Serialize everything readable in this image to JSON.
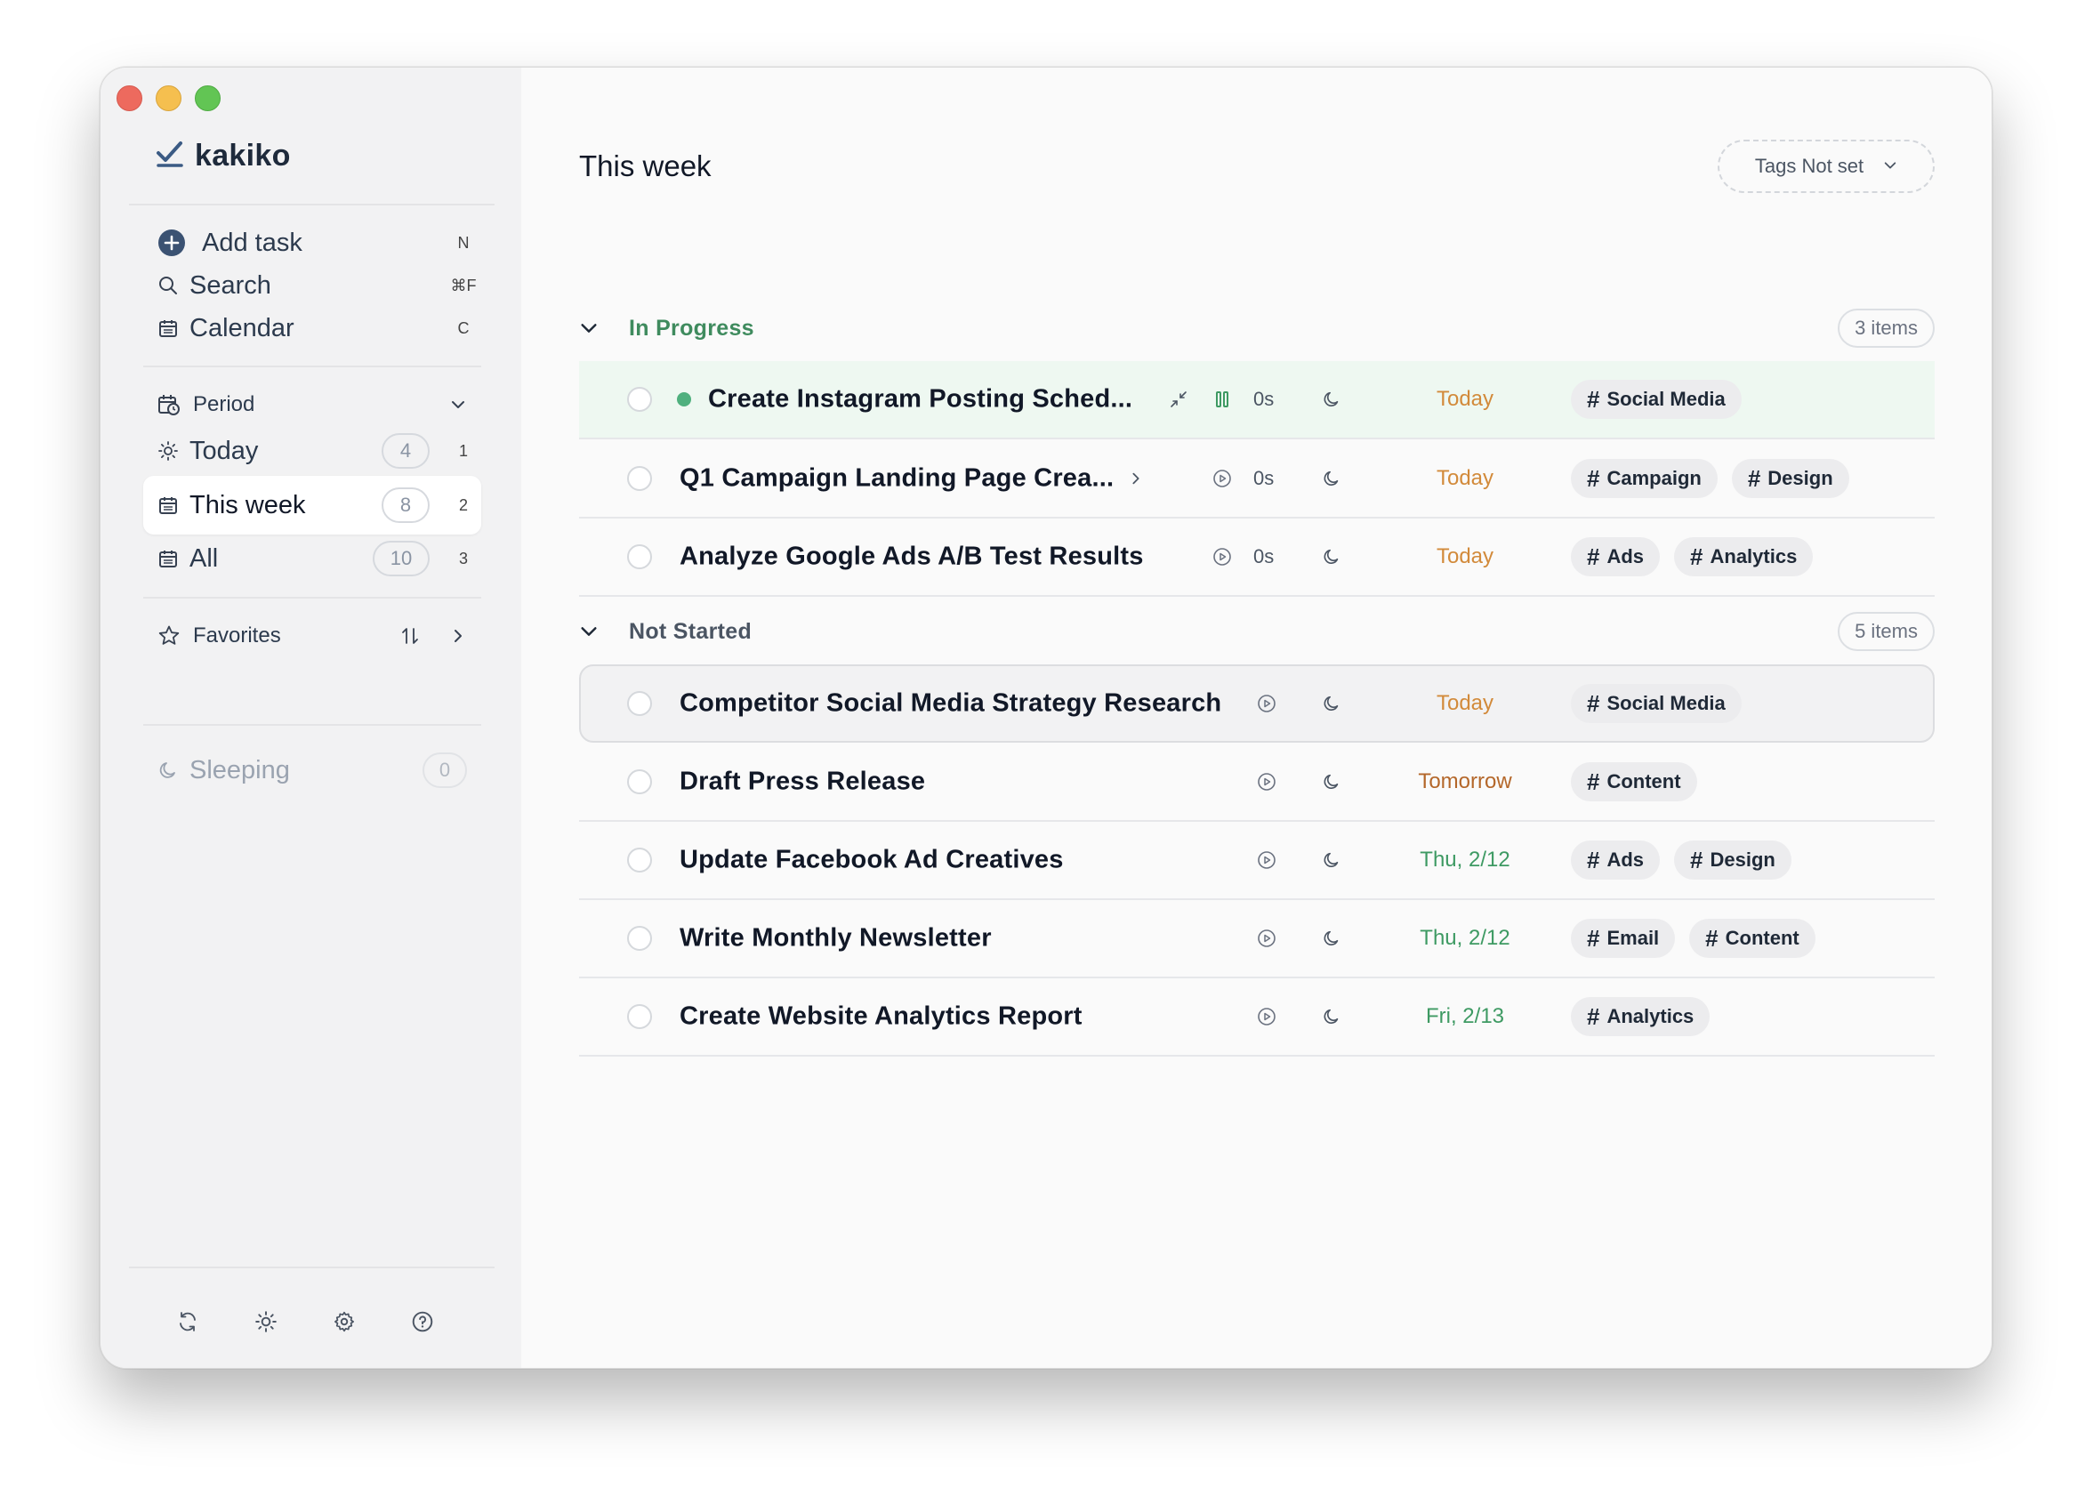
{
  "app": {
    "name": "kakiko",
    "colors": {
      "in_progress_green": "#3f8b5e",
      "today_orange": "#d28a3a",
      "tomorrow_orange": "#b4672a",
      "future_green": "#3e9a63",
      "live_dot": "#4fb07e"
    }
  },
  "sidebar": {
    "add_task": {
      "label": "Add task",
      "shortcut": "N",
      "icon": "plus-circle-icon"
    },
    "search": {
      "label": "Search",
      "shortcut": "⌘F",
      "icon": "search-icon"
    },
    "calendar": {
      "label": "Calendar",
      "shortcut": "C",
      "icon": "calendar-icon"
    },
    "period": {
      "label": "Period",
      "icon": "calendar-clock-icon"
    },
    "views": [
      {
        "label": "Today",
        "count": "4",
        "shortcut": "1",
        "icon": "sun-icon",
        "active": false
      },
      {
        "label": "This week",
        "count": "8",
        "shortcut": "2",
        "icon": "calendar-icon",
        "active": true
      },
      {
        "label": "All",
        "count": "10",
        "shortcut": "3",
        "icon": "calendar-icon",
        "active": false
      }
    ],
    "favorites": {
      "label": "Favorites",
      "icon": "star-icon"
    },
    "sleeping": {
      "label": "Sleeping",
      "count": "0",
      "icon": "moon-icon"
    }
  },
  "main": {
    "title": "This week",
    "tags_filter": "Tags Not set",
    "groups": [
      {
        "title": "In Progress",
        "count_label": "3 items"
      },
      {
        "title": "Not Started",
        "count_label": "5 items"
      }
    ],
    "tasks": [
      {
        "title": "Create Instagram Posting Sched...",
        "time": "0s",
        "date": "Today",
        "tags": [
          "Social Media"
        ]
      },
      {
        "title": "Q1 Campaign Landing Page Crea...",
        "time": "0s",
        "date": "Today",
        "tags": [
          "Campaign",
          "Design"
        ]
      },
      {
        "title": "Analyze Google Ads A/B Test Results",
        "time": "0s",
        "date": "Today",
        "tags": [
          "Ads",
          "Analytics"
        ]
      },
      {
        "title": "Competitor Social Media Strategy Research",
        "date": "Today",
        "tags": [
          "Social Media"
        ]
      },
      {
        "title": "Draft Press Release",
        "date": "Tomorrow",
        "tags": [
          "Content"
        ]
      },
      {
        "title": "Update Facebook Ad Creatives",
        "date": "Thu, 2/12",
        "tags": [
          "Ads",
          "Design"
        ]
      },
      {
        "title": "Write Monthly Newsletter",
        "date": "Thu, 2/12",
        "tags": [
          "Email",
          "Content"
        ]
      },
      {
        "title": "Create Website Analytics Report",
        "date": "Fri, 2/13",
        "tags": [
          "Analytics"
        ]
      }
    ]
  }
}
